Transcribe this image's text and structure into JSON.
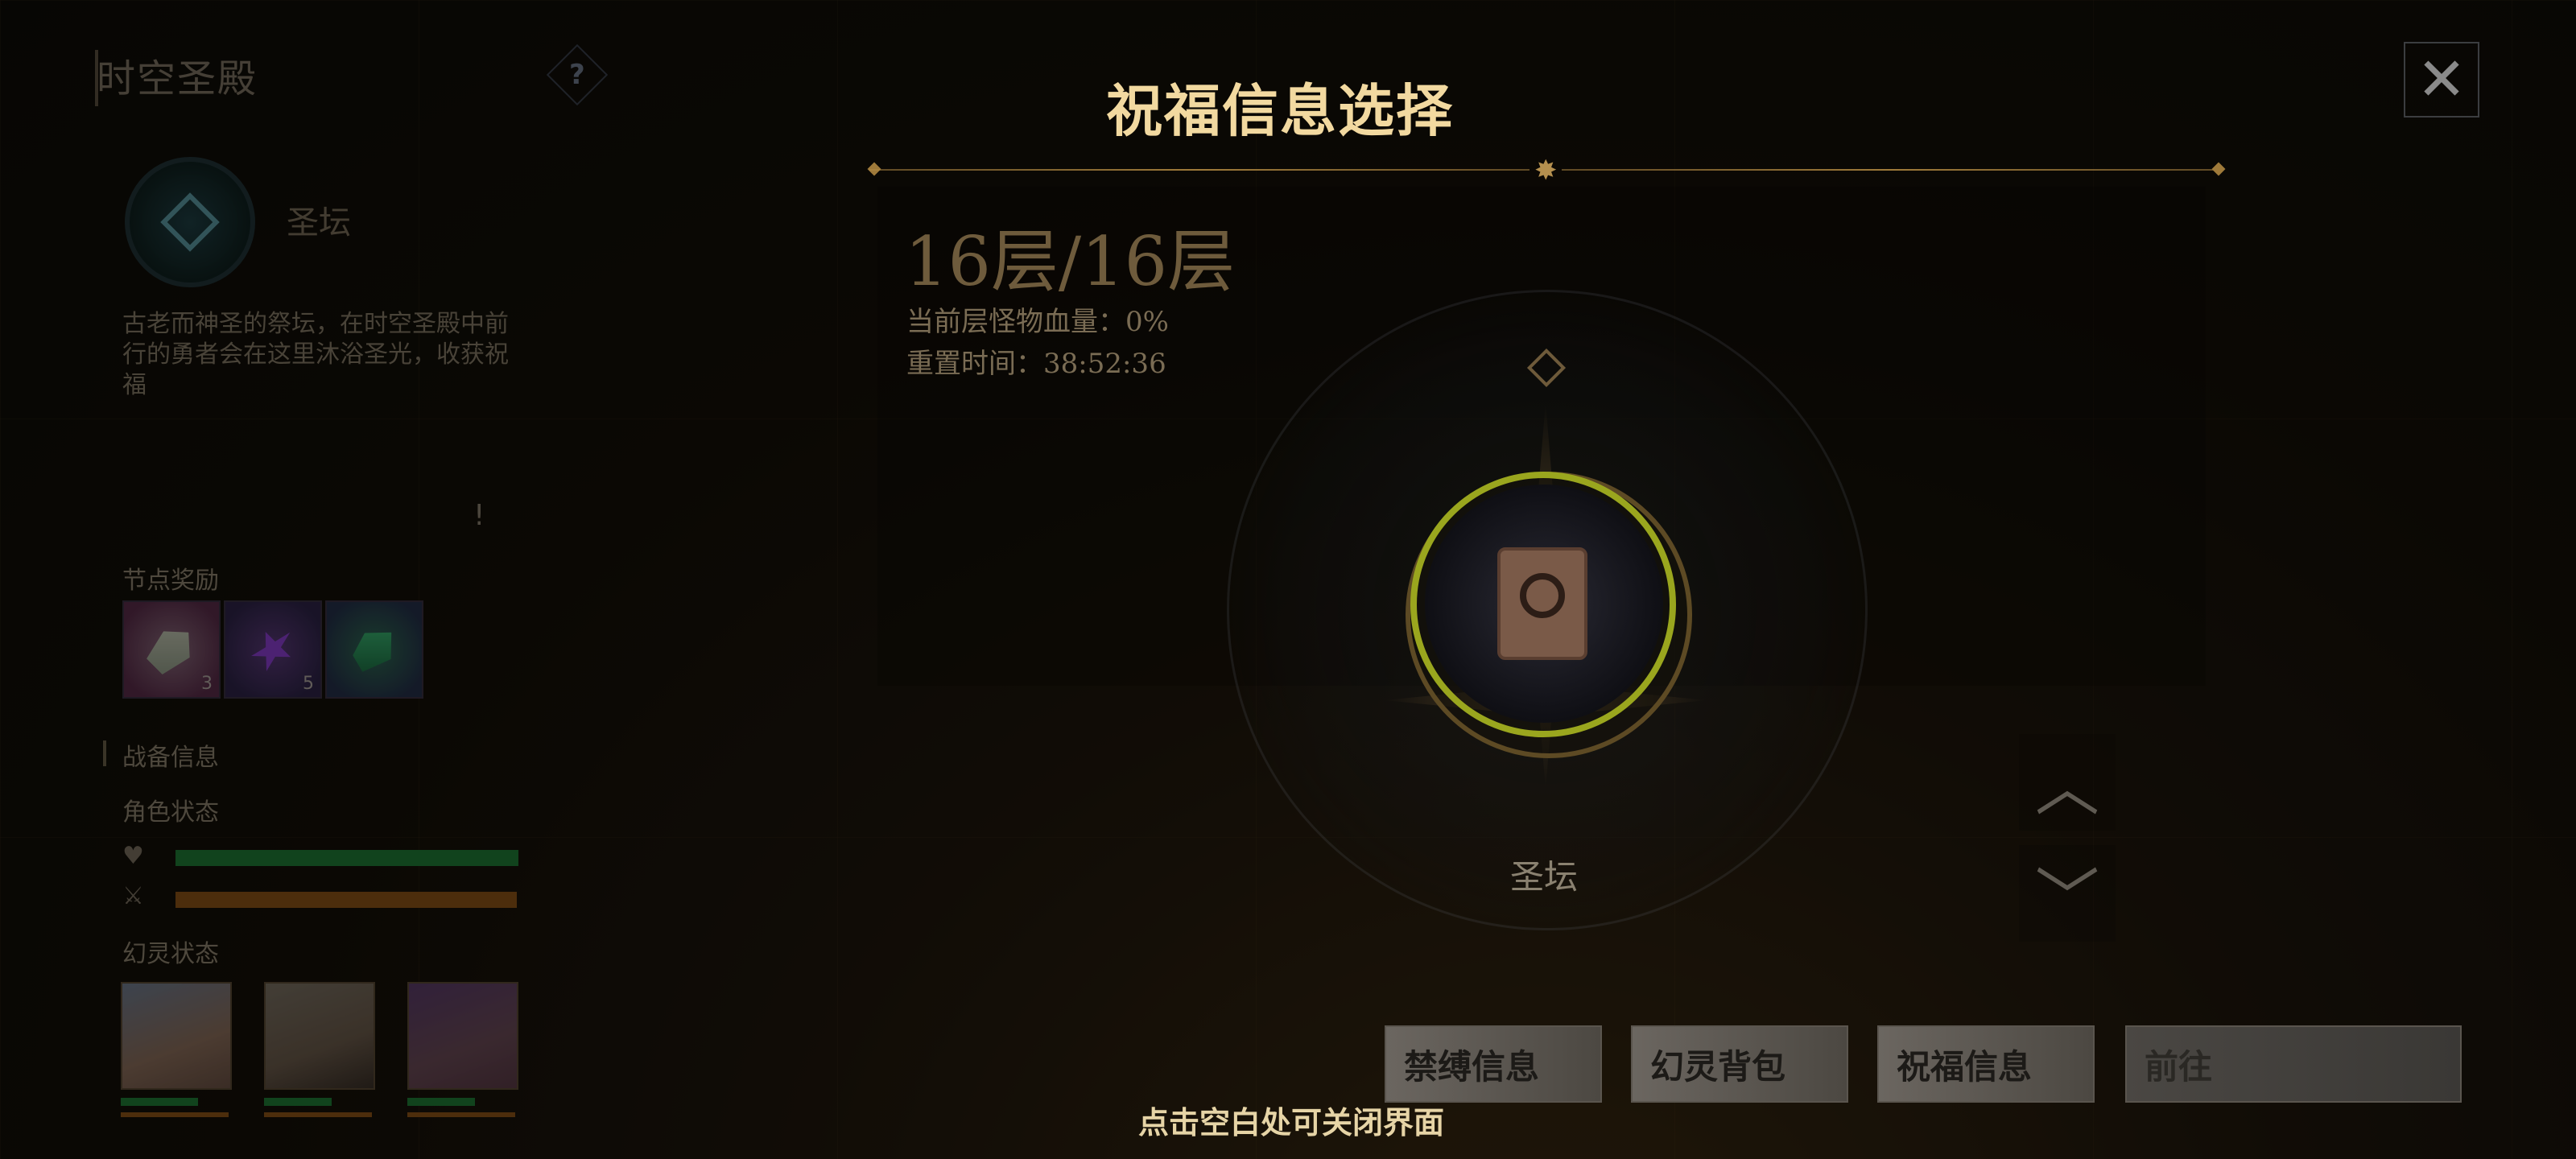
{
  "page": {
    "title": "时空圣殿",
    "help_icon": "?",
    "close_icon": "✕"
  },
  "node_detail": {
    "name": "圣坛",
    "description": "古老而神圣的祭坛，在时空圣殿中前行的勇者会在这里沐浴圣光，收获祝福",
    "alert": "!",
    "reward_label": "节点奖励",
    "rewards": [
      {
        "icon": "pale-crystal-icon",
        "count": "3"
      },
      {
        "icon": "purple-star-crystal-icon",
        "count": "5"
      },
      {
        "icon": "green-crystal-icon",
        "count": ""
      }
    ]
  },
  "battle_info": {
    "section_title": "战备信息",
    "character_status_label": "角色状态",
    "hp_icon": "heart-icon",
    "energy_icon": "sword-icon",
    "hp_fraction": 1.0,
    "energy_fraction": 1.0,
    "spirit_status_label": "幻灵状态",
    "spirits": [
      {
        "name": "spirit-white-hair"
      },
      {
        "name": "spirit-silver-hair"
      },
      {
        "name": "spirit-purple-hair"
      }
    ]
  },
  "modal": {
    "title": "祝福信息选择",
    "divider_ornament": "✸",
    "floor": "16层/16层",
    "monster_hp": "当前层怪物血量：0%",
    "reset_time": "重置时间：38:52:36",
    "node_label": "圣坛",
    "up_arrow": "︿",
    "down_arrow": "﹀",
    "buttons": [
      "禁缚信息",
      "幻灵背包",
      "祝福信息",
      "前往"
    ],
    "close_hint": "点击空白处可关闭界面"
  },
  "colors": {
    "accent_gold": "#f2d9a0",
    "hp_green": "#1f7a36",
    "energy_orange": "#8a5216",
    "node_ring": "#9aa61e"
  }
}
